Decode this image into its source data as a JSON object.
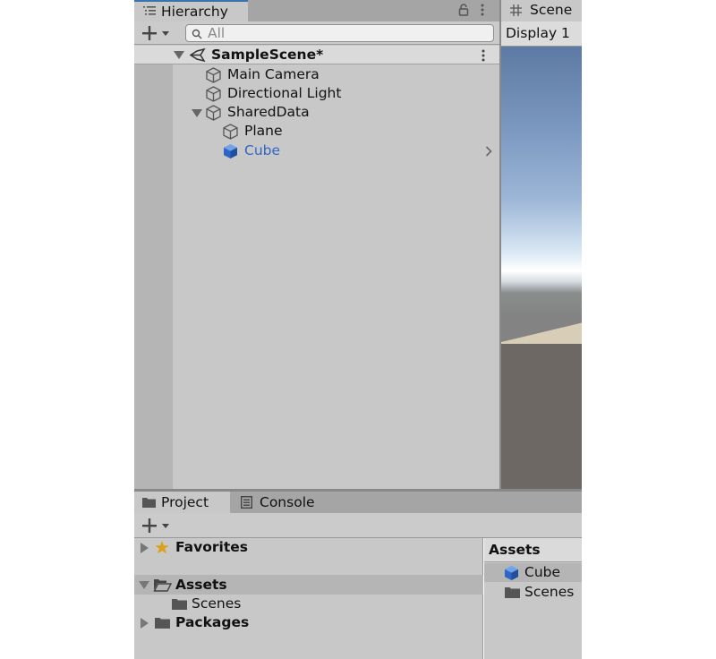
{
  "hierarchy": {
    "tab_label": "Hierarchy",
    "search_placeholder": "All",
    "scene_name": "SampleScene*",
    "items": [
      {
        "label": "Main Camera",
        "icon": "gameobject-cube-icon"
      },
      {
        "label": "Directional Light",
        "icon": "gameobject-cube-icon"
      },
      {
        "label": "SharedData",
        "icon": "gameobject-cube-icon",
        "expanded": true
      },
      {
        "label": "Plane",
        "icon": "gameobject-cube-icon"
      },
      {
        "label": "Cube",
        "icon": "prefab-cube-icon",
        "color": "#2f66c6"
      }
    ]
  },
  "scene_view": {
    "tab_label": "Scene",
    "display_label": "Display 1"
  },
  "project": {
    "tabs": [
      {
        "label": "Project",
        "icon": "folder-icon",
        "active": true
      },
      {
        "label": "Console",
        "icon": "console-icon",
        "active": false
      }
    ],
    "tree": [
      {
        "label": "Favorites",
        "icon": "star-icon"
      },
      {
        "label": "Assets",
        "icon": "folder-open-icon",
        "selected": true
      },
      {
        "label": "Scenes",
        "icon": "folder-icon"
      },
      {
        "label": "Packages",
        "icon": "folder-icon"
      }
    ],
    "assets_panel": {
      "header": "Assets",
      "items": [
        {
          "label": "Cube",
          "icon": "prefab-cube-icon",
          "selected": true
        },
        {
          "label": "Scenes",
          "icon": "folder-icon"
        }
      ]
    }
  },
  "colors": {
    "accent": "#3a72b0",
    "prefab_blue": "#2f66c6",
    "favorites_star": "#d9a21a"
  }
}
